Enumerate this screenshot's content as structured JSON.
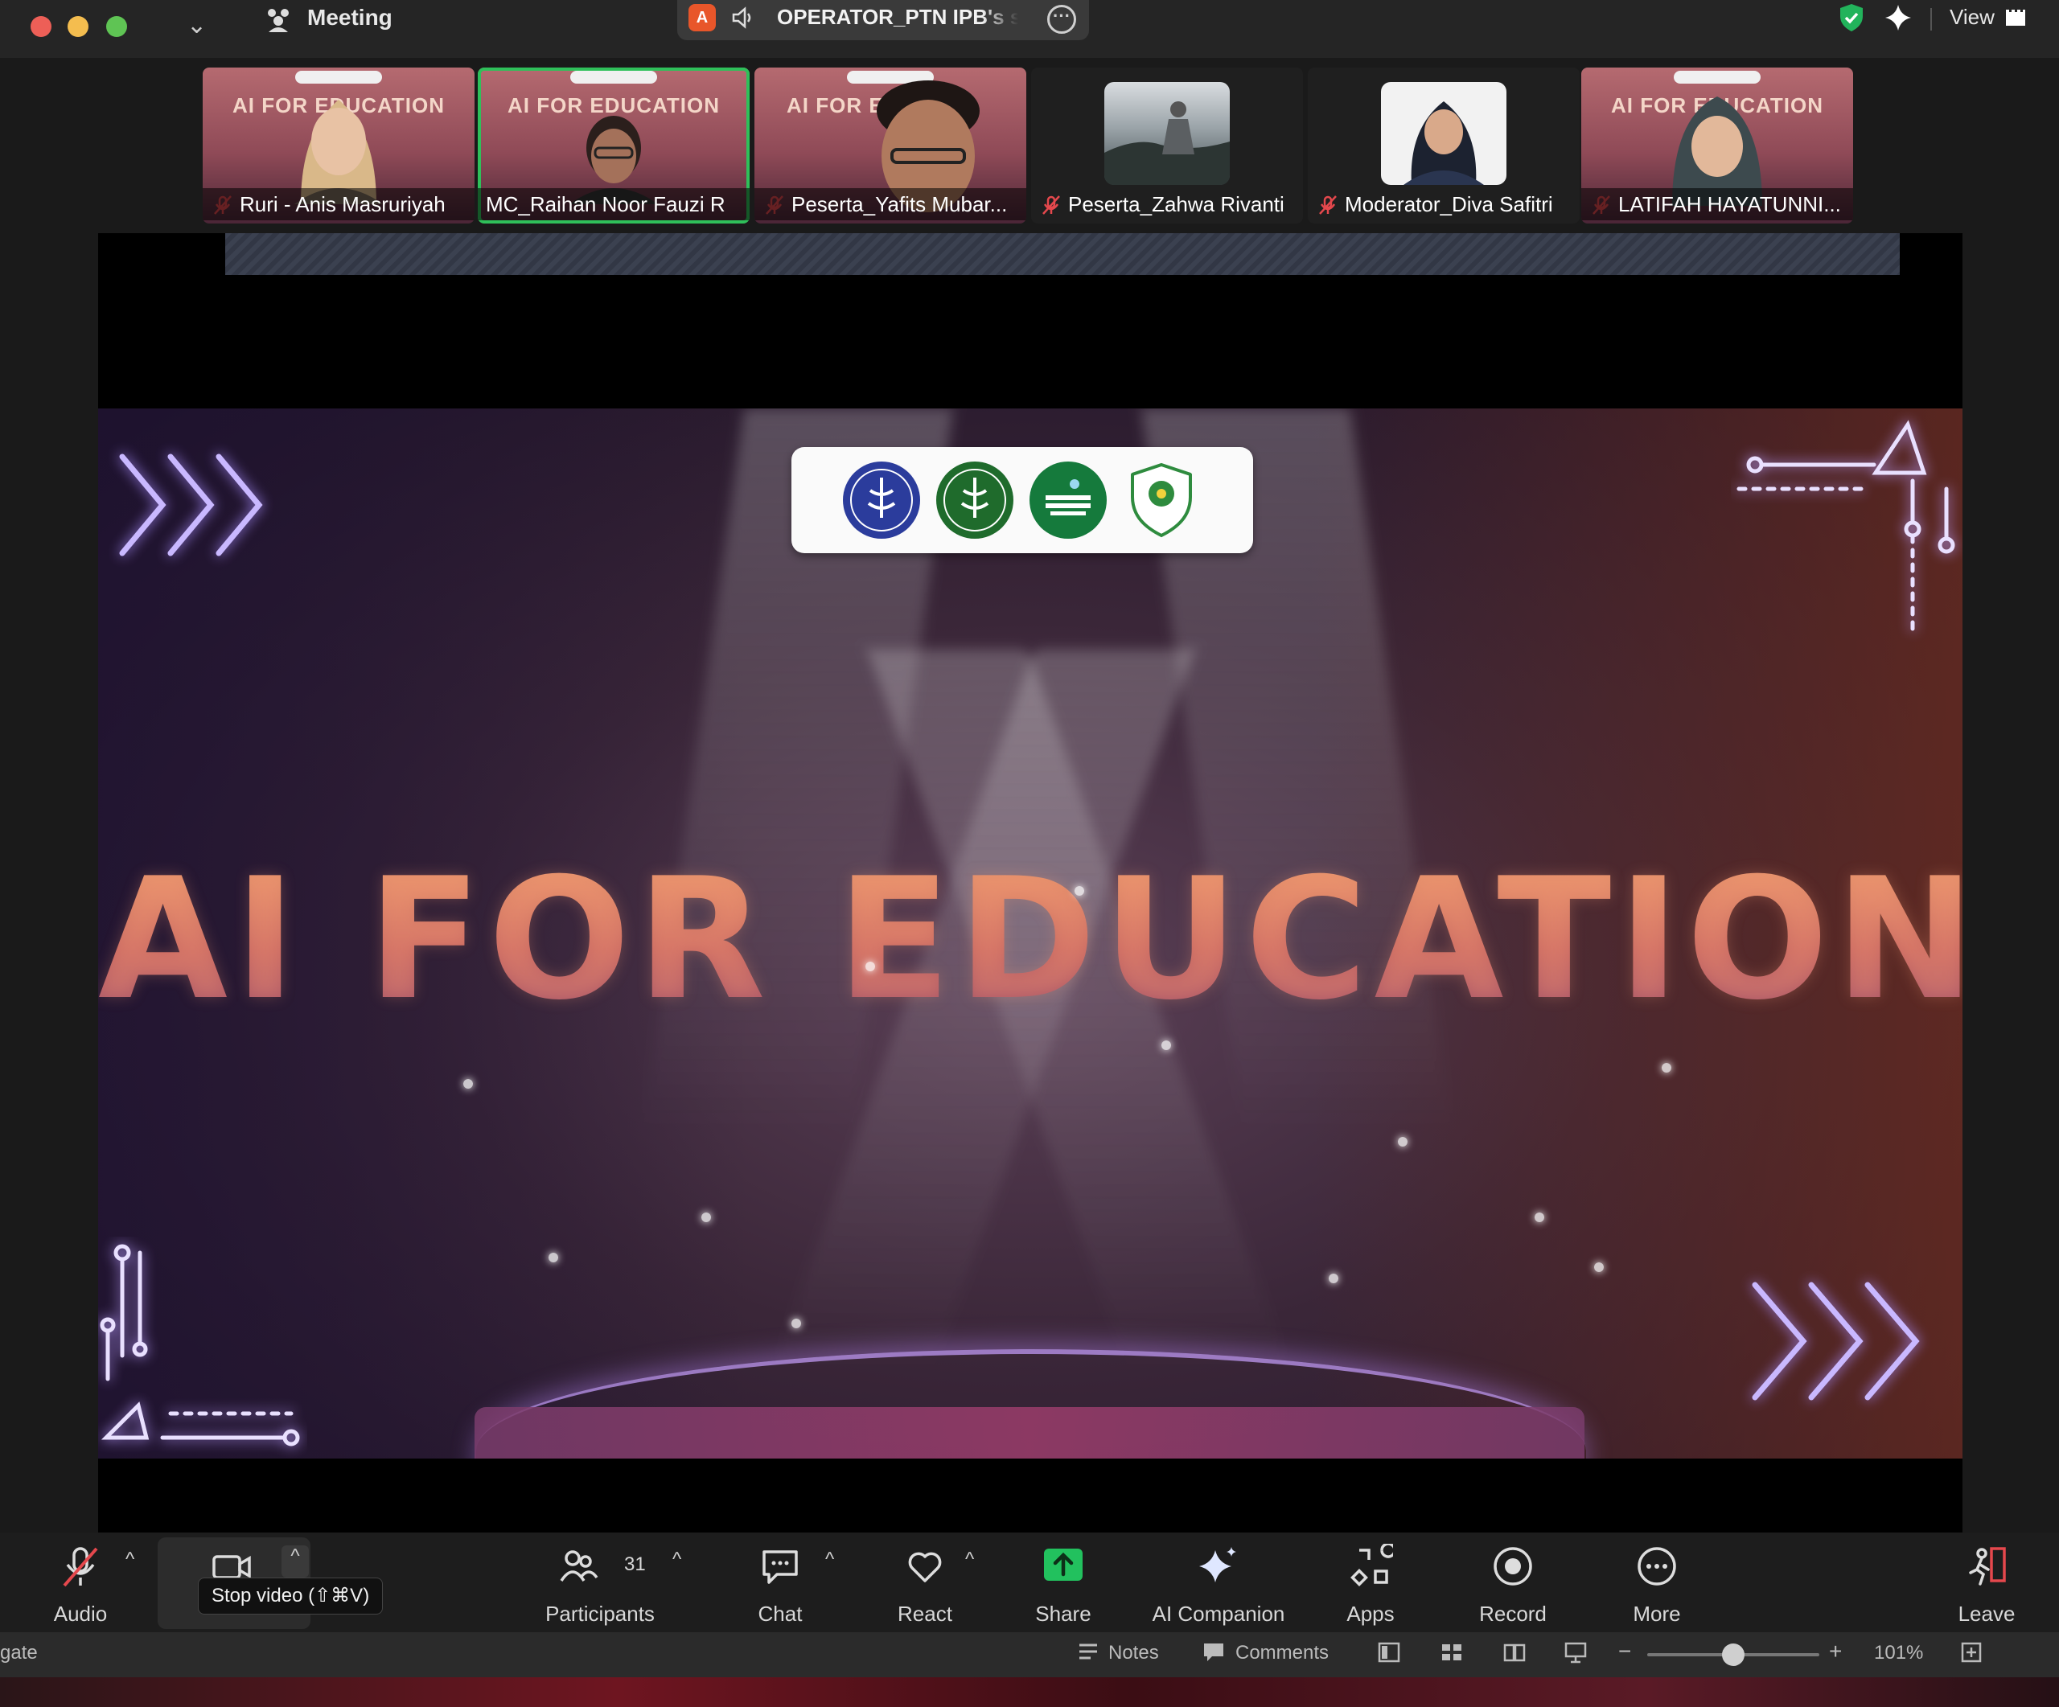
{
  "titlebar": {
    "meeting_label": "Meeting",
    "share_badge": "A",
    "share_title": "OPERATOR_PTN IPB's sc",
    "view_label": "View"
  },
  "participants": [
    {
      "name": "Ruri - Anis Masruriyah",
      "tile": "poster",
      "poster_text": "AI FOR EDUCATION",
      "muted": true,
      "active": false
    },
    {
      "name": "MC_Raihan Noor Fauzi R",
      "tile": "poster",
      "poster_text": "AI FOR EDUCATION",
      "muted": false,
      "active": true
    },
    {
      "name": "Peserta_Yafits Mubar...",
      "tile": "poster",
      "poster_text": "AI FOR EDU",
      "muted": true,
      "active": false
    },
    {
      "name": "Peserta_Zahwa Rivanti",
      "tile": "photo",
      "muted": true,
      "active": false
    },
    {
      "name": "Moderator_Diva Safitri",
      "tile": "photo",
      "muted": true,
      "active": false
    },
    {
      "name": "LATIFAH HAYATUNNI...",
      "tile": "poster",
      "poster_text": "AI FOR EDUCATION",
      "muted": true,
      "active": false
    }
  ],
  "slide": {
    "title": "AI FOR EDUCATION"
  },
  "toolbar": {
    "audio": "Audio",
    "video": "Stop video (⇧⌘V)",
    "participants": "Participants",
    "participants_count": "31",
    "chat": "Chat",
    "react": "React",
    "share": "Share",
    "ai_companion": "AI Companion",
    "apps": "Apps",
    "record": "Record",
    "more": "More",
    "leave": "Leave"
  },
  "statusbar": {
    "left_text": "gate",
    "notes": "Notes",
    "comments": "Comments",
    "zoom_level": "101%",
    "zoom_fraction": 0.5
  },
  "colors": {
    "active_speaker": "#2fc05a",
    "share_green": "#22c15e",
    "leave_red": "#e5484d",
    "mute_red": "#e5484d"
  }
}
